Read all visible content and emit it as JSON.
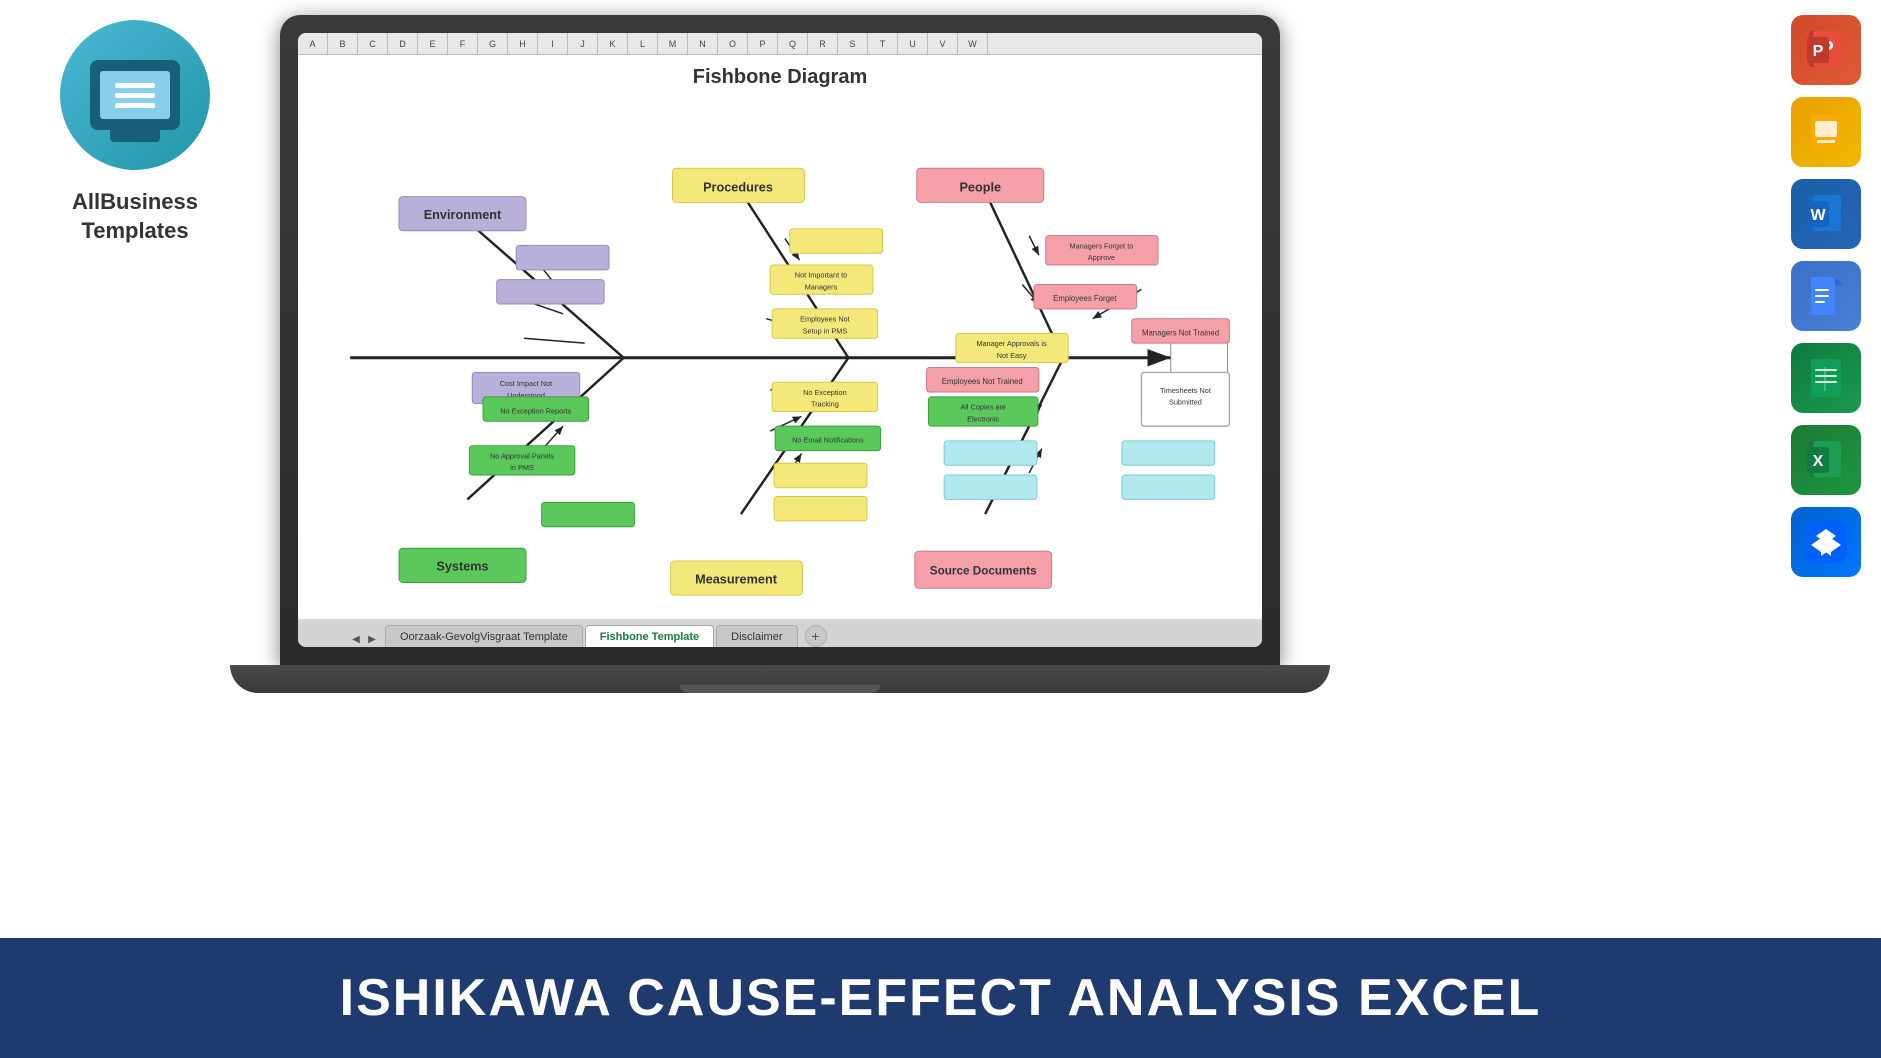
{
  "brand": {
    "name": "AllBusiness\nTemplates"
  },
  "diagram": {
    "title": "Fishbone Diagram",
    "categories": {
      "environment": "Environment",
      "procedures": "Procedures",
      "people": "People",
      "systems": "Systems",
      "measurement": "Measurement",
      "source_documents": "Source Documents"
    },
    "nodes": {
      "managers_forget": "Managers Forget to Approve",
      "employees_forget": "Employees Forget",
      "managers_not_trained": "Managers Not Trained",
      "manager_approvals": "Manager Approvals is Not Easy",
      "employees_not_trained": "Employees Not Trained",
      "timesheets_not_submitted": "Timesheets Not Submitted",
      "not_important": "Not Important to Managers",
      "employees_not_setup": "Employees Not Setup in PMS",
      "cost_impact": "Cost Impact Not Understood",
      "no_exception_reports": "No Exception Reports",
      "no_exception_tracking": "No Exception Tracking",
      "all_copies_electronic": "All Copies are Electronic",
      "no_email_notifications": "No Email Notifications",
      "no_approval_panels": "No Approval Panels in PMS"
    },
    "tabs": {
      "tab1": "Oorzaak-GevolgVisgraat Template",
      "tab2": "Fishbone Template",
      "tab3": "Disclaimer"
    }
  },
  "banner": {
    "text": "ISHIKAWA CAUSE-EFFECT ANALYSIS  EXCEL"
  },
  "icons": {
    "powerpoint": "P",
    "slides": "▶",
    "word": "W",
    "docs": "≡",
    "sheets": "⊞",
    "excel": "X",
    "dropbox": "❖"
  }
}
